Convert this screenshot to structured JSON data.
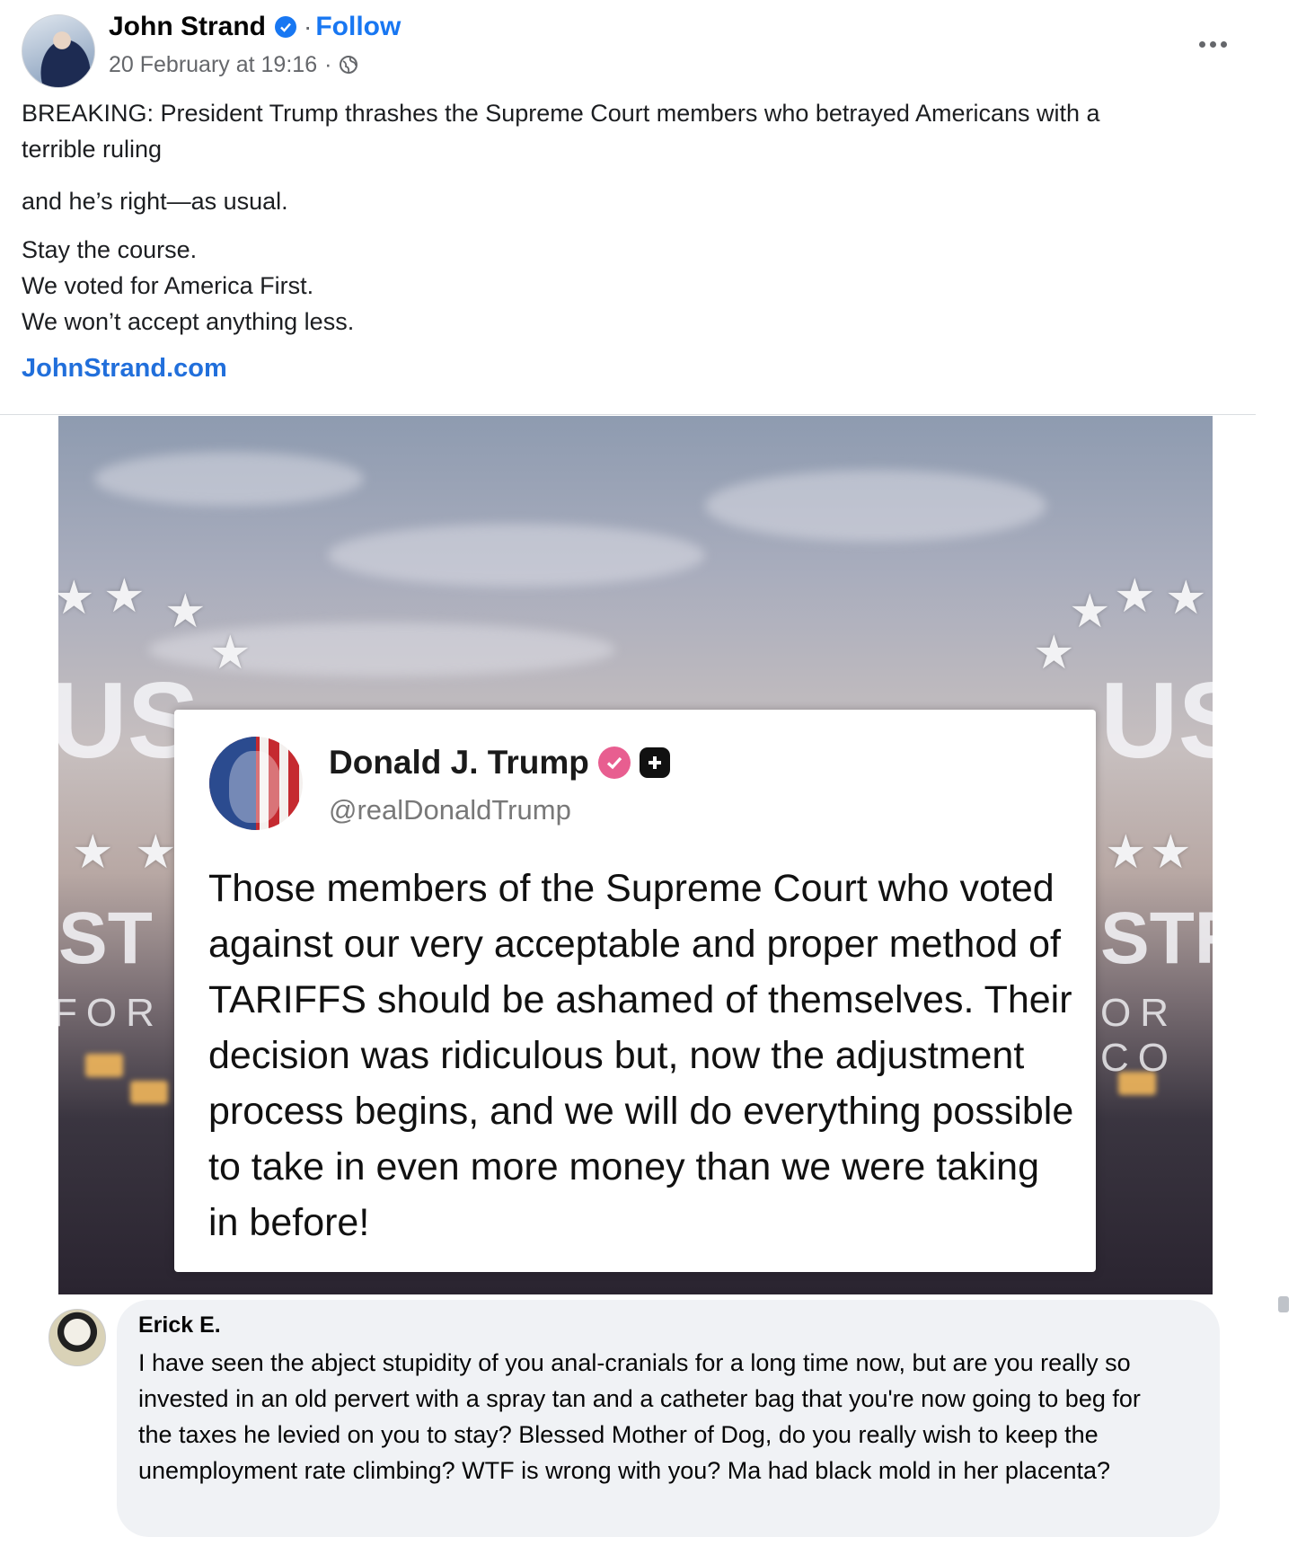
{
  "post": {
    "author": "John Strand",
    "follow_label": "Follow",
    "dot": "·",
    "timestamp": "20 February at 19:16",
    "meta_dot": "·",
    "paragraphs": [
      "BREAKING: President Trump thrashes the Supreme Court members who betrayed Americans with a\nterrible ruling",
      "and he’s right—as usual.",
      "Stay the course.\nWe voted for America First.\nWe won’t accept anything less."
    ],
    "link": "JohnStrand.com"
  },
  "shared_image": {
    "bg_letters_left": "US",
    "bg_letters_right": "US",
    "bg_strip_left": "ST",
    "bg_strip_right": "STR",
    "bg_sub_left": "FOR C",
    "bg_sub_right": "OR CO",
    "truth": {
      "name": "Donald J. Trump",
      "handle": "@realDonaldTrump",
      "body": "Those members of the Supreme Court who voted against our very acceptable and proper method of TARIFFS should be ashamed of themselves. Their decision was ridiculous but, now the adjustment process begins, and we will do everything possible to take in even more money than we were taking in before!"
    }
  },
  "comment": {
    "author": "Erick E.",
    "text": "I have seen the abject stupidity of you anal-cranials for a long time now, but are you really so invested in an old pervert with a spray tan and a catheter bag that you're now going to beg for the taxes he levied on you to stay? Blessed Mother of Dog, do you really wish to keep the unemployment rate climbing? WTF is wrong with you? Ma had black mold in her placenta?"
  },
  "colors": {
    "link_blue": "#1877f2",
    "verified_pink": "#e85e90",
    "comment_bg": "#f0f2f5"
  },
  "icons": [
    "verified-badge-icon",
    "globe-icon",
    "more-options-icon",
    "truth-verified-icon",
    "truth-plus-icon"
  ]
}
